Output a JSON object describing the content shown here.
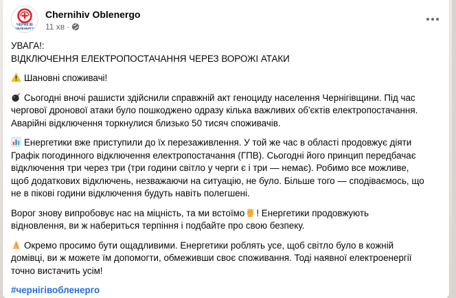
{
  "post": {
    "author": "Chernihiv Oblenergo",
    "time": "11 хв",
    "separator": "·",
    "avatar_label": "ЧЕРНІГІВ\nОБЛЕНЕРГО",
    "avatar_label_top": "ЧЕРНІГІВ",
    "avatar_label_bottom": "ОБЛЕНЕРГО",
    "privacy_icon": "globe-icon",
    "more_icon": "more-options-icon"
  },
  "content": {
    "heading1": "УВАГА!:",
    "heading2": "ВІДКЛЮЧЕННЯ ЕЛЕКТРОПОСТАЧАННЯ ЧЕРЕЗ ВОРОЖІ АТАКИ",
    "p1": "Шановні споживачі!",
    "p2_l1": "Сьогодні вночі рашисти здійснили справжній акт геноциду населення Чернігівщини. Під час",
    "p2_l2": "чергової дронової атаки було пошкоджено одразу кілька важливих об'єктів електропостачання.",
    "p2_l3": "Аварійні відключення торкнулися близько 50 тисяч споживачів.",
    "p3_l1": "Енергетики вже приступили до їх перезаживлення. У той же час в області продовжує діяти",
    "p3_l2": "Графік погодинного відключення електропостачання (ГПВ). Сьогодні його принцип передбачає",
    "p3_l3": "відключення три через три (три години світло у черги є і три — немає). Робимо все можливе,",
    "p3_l4": "щоб додаткових відключень, незважаючи на ситуацію, не було. Більше того — сподіваємось, що",
    "p3_l5": "не в пікові години відключення будуть навіть полегшені.",
    "p4_l1a": "Ворог знову випробовує нас на міцність, та ми встоїмо",
    "p4_l1b": "! Енергетики продовжують",
    "p4_l2": "відновлення, ви ж набериться терпіння і подбайте про свою безпеку.",
    "p5_l1": "Окремо просимо бути ощадливими. Енергетики роблять усе, щоб світло було в кожній",
    "p5_l2": "домівці, ви ж можете їм допомогти, обмеживши своє споживання. Тоді наявної електроенергії",
    "p5_l3": "точно вистачить усім!",
    "hashtag": "#чернігівобленерго"
  },
  "icons": {
    "warning": "warning-icon",
    "bomb": "bomb-icon",
    "chart": "bar-chart-icon",
    "fist": "raised-fist-icon",
    "pray": "folded-hands-icon"
  },
  "colors": {
    "brand_red": "#e31e24",
    "brand_blue": "#1f4e9e",
    "hashtag": "#216fdb",
    "text": "#050505",
    "muted": "#65676b"
  }
}
